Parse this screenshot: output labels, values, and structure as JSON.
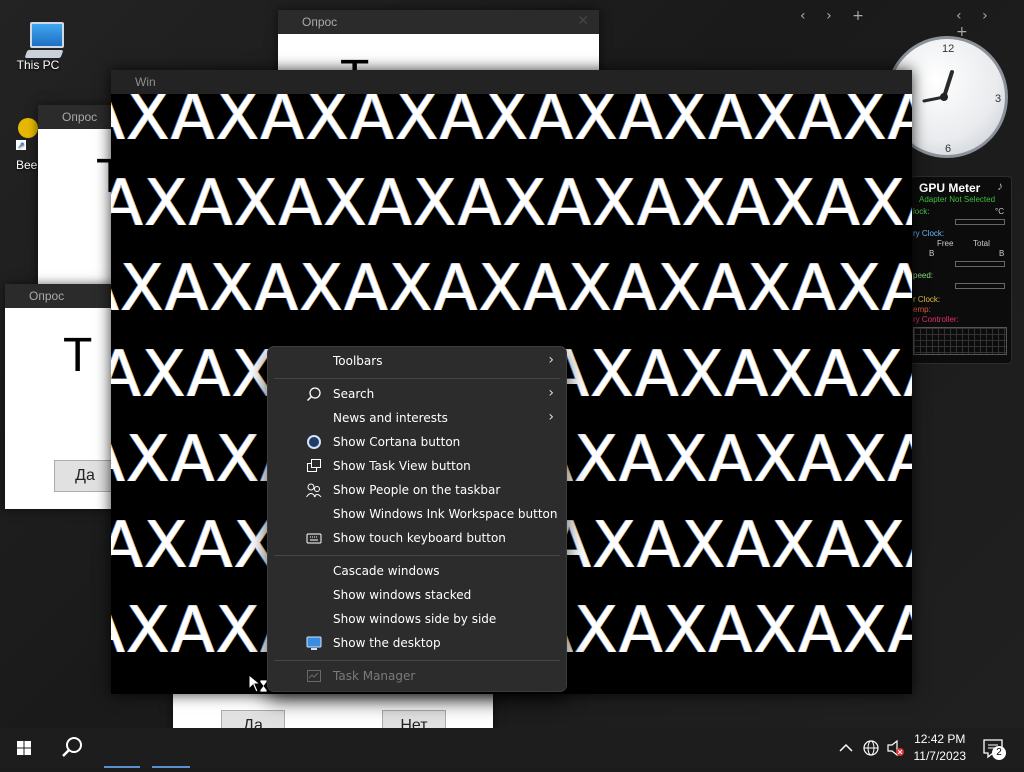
{
  "desktop": {
    "icons": [
      {
        "label": "This PC"
      },
      {
        "label": "Beeb"
      }
    ]
  },
  "gadgets": {
    "left_nav": {
      "prev": "‹",
      "next": "›",
      "add": "+"
    },
    "right_nav": {
      "prev": "‹",
      "next": "›",
      "add": "+"
    },
    "clock": {
      "n12": "12",
      "n3": "3",
      "n6": "6"
    },
    "gpu_meter": {
      "title": "GPU Meter",
      "adapter": "Adapter Not Selected",
      "clock_lbl": "lock:",
      "unit_c": "°C",
      "mem_clock": "ry Clock:",
      "free": "Free",
      "total": "Total",
      "b1": "B",
      "b2": "B",
      "speed": "peed:",
      "sh_clock": "r Clock:",
      "temp": "emp:",
      "ctrl": "ry Controller:"
    }
  },
  "dialogs": [
    {
      "title": "Опрос",
      "close": "✕",
      "big": "Т"
    },
    {
      "title": "Опрос",
      "close": "✕",
      "big": "Т"
    },
    {
      "title": "Опрос",
      "close": "✕",
      "big": "Т",
      "yes": "Да"
    },
    {
      "title": "Опрос",
      "yes": "Да",
      "no": "Нет"
    }
  ],
  "main_window": {
    "title": "Win",
    "pattern_text": "AXAXAXAXAXAXAXAXAXAXAXAXAXAXAXAX"
  },
  "context_menu": {
    "items": [
      {
        "label": "Toolbars",
        "submenu": true
      },
      {
        "label": "Search",
        "submenu": true,
        "icon": "search-icon"
      },
      {
        "label": "News and interests",
        "submenu": true
      },
      {
        "label": "Show Cortana button",
        "icon": "cortana-icon"
      },
      {
        "label": "Show Task View button",
        "icon": "task-view-icon"
      },
      {
        "label": "Show People on the taskbar",
        "icon": "people-icon"
      },
      {
        "label": "Show Windows Ink Workspace button"
      },
      {
        "label": "Show touch keyboard button",
        "icon": "keyboard-icon"
      },
      {
        "label": "Cascade windows"
      },
      {
        "label": "Show windows stacked"
      },
      {
        "label": "Show windows side by side"
      },
      {
        "label": "Show the desktop",
        "icon": "desktop-icon"
      },
      {
        "label": "Task Manager",
        "disabled": true,
        "icon": "task-manager-icon"
      }
    ]
  },
  "taskbar": {
    "time": "12:42 PM",
    "date": "11/7/2023",
    "notifications": "2"
  }
}
